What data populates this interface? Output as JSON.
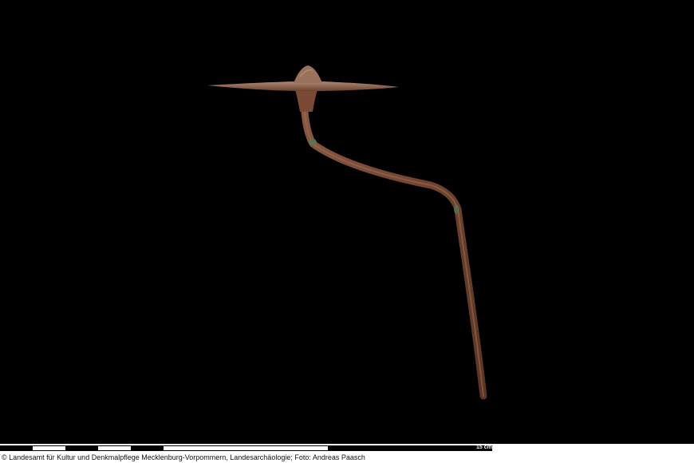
{
  "photo": {
    "subject": "bronze-pin-icon",
    "background_color": "#000000",
    "object_color": "#7a4a33",
    "patina_color": "#4f7a5a"
  },
  "scale_bar": {
    "label": "15 cm"
  },
  "credit": "© Landesamt für Kultur und Denkmalpflege Mecklenburg-Vorpommern, Landesarchäologie;  Foto: Andreas Paasch"
}
